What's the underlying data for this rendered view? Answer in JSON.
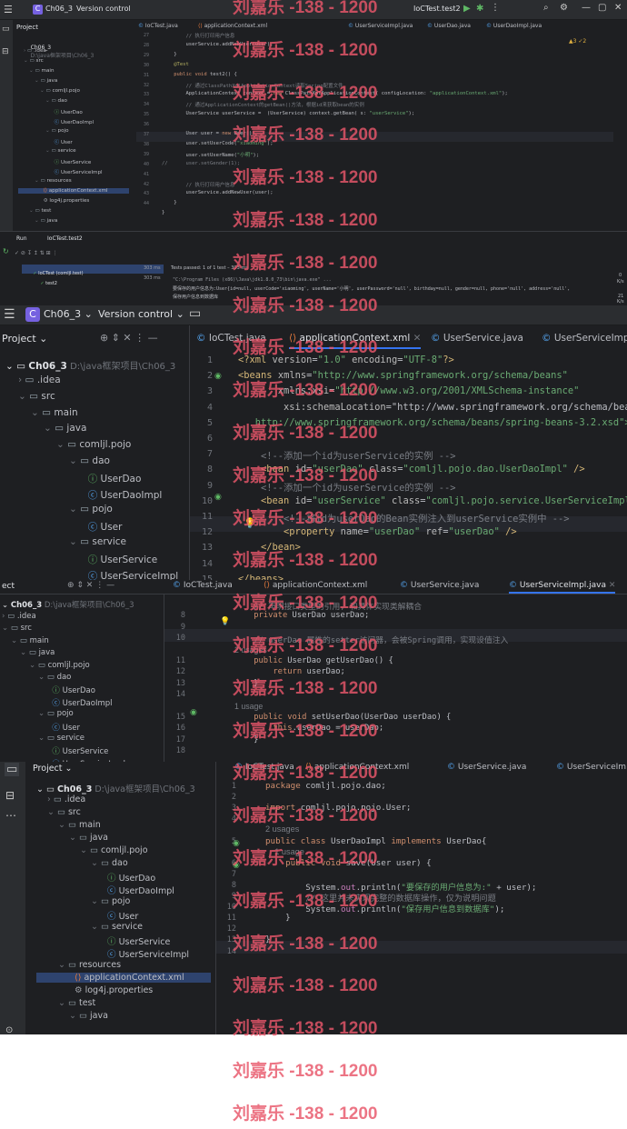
{
  "common": {
    "project_label": "Project",
    "project_name": "Ch06_3",
    "project_path": "D:\\java框架项目\\Ch06_3",
    "vc_label": "Version control",
    "badge_letter": "C"
  },
  "panel1": {
    "run_config": "IoCTest.test2",
    "tabs": [
      "IoCTest.java",
      "applicationContext.xml",
      "UserServiceImpl.java",
      "UserDao.java",
      "UserDaoImpl.java"
    ],
    "tree": [
      ".idea",
      "src",
      "main",
      "java",
      "comljl.pojo",
      "dao",
      "UserDao",
      "UserDaoImpl",
      "pojo",
      "User",
      "service",
      "UserService",
      "UserServiceImpl",
      "resources",
      "applicationContext.xml",
      "log4j.properties",
      "test",
      "java"
    ],
    "gutter": [
      "27",
      "28",
      "29",
      "30",
      "31",
      "32",
      "33",
      "34",
      "35",
      "36",
      "37",
      "38",
      "39",
      "40",
      "41",
      "42",
      "43",
      "44"
    ],
    "code": [
      "        // 执行打印用户信息",
      "        userService.addNewUser(user);",
      "    }",
      "    @Test",
      "    public void test2() {",
      "        // 通过ClassPathXmlApplicationContext读取Spring配置文件",
      "        ApplicationContext context = new ClassPathXmlApplicationContext( configLocation: \"applicationContext.xml\");",
      "        // 通过ApplicationContext的getBean()方法，根据id来获取bean的实例",
      "        UserService userService =  (UserService) context.getBean( s: \"userService\");",
      "",
      "        User user = new User();",
      "        user.setUserCode(\"xiaoming\");",
      "        user.setUserName(\"小明\");",
      "//      user.setGender(1);",
      "",
      "        // 执行打印用户信息",
      "        userService.addNewUser(user);",
      "    }",
      "}"
    ],
    "inspections": "▲3 ✓2",
    "run_label": "Run",
    "run_tab": "IoCTest.test2",
    "tests_passed": "Tests passed: 1 of 1 test – 303 ms",
    "test_class": "IoCTest (comljl.test)",
    "test_class_time": "303 ms",
    "test_method": "test2",
    "test_method_time": "303 ms",
    "console": [
      "\"C:\\Program Files (x86)\\Java\\jdk1.8.0_73\\bin\\java.exe\" ...",
      "要保存的用户信息为:User{id=null, userCode='xiaoming', userName='小明', userPassword='null', birthday=null, gender=null, phone='null', address='null',",
      "保存用户信息到数据库"
    ],
    "status_right": [
      "0",
      "K/s",
      "21",
      "K/s"
    ]
  },
  "panel2": {
    "tabs": [
      "IoCTest.java",
      "applicationContext.xml",
      "UserService.java",
      "UserServiceImpl.java"
    ],
    "tree": [
      "Ch06_3",
      ".idea",
      "src",
      "main",
      "java",
      "comljl.pojo",
      "dao",
      "UserDao",
      "UserDaoImpl",
      "pojo",
      "User",
      "service",
      "UserService",
      "UserServiceImpl"
    ],
    "gutter": [
      "1",
      "2",
      "3",
      "4",
      "5",
      "6",
      "7",
      "8",
      "9",
      "10",
      "11",
      "12",
      "13",
      "14",
      "15"
    ],
    "code": [
      "<?xml version=\"1.0\" encoding=\"UTF-8\"?>",
      "<beans xmlns=\"http://www.springframework.org/schema/beans\"",
      "       xmlns:xsi=\"http://www.w3.org/2001/XMLSchema-instance\"",
      "        xsi:schemaLocation=\"http://www.springframework.org/schema/beans",
      "   http://www.springframework.org/schema/beans/spring-beans-3.2.xsd\">",
      "",
      "    <!--添加一个id为userService的实例 -->",
      "    <bean id=\"userDao\" class=\"comljl.pojo.dao.UserDaoImpl\" />",
      "    <!--添加一个id为userService的实例 -->",
      "    <bean id=\"userService\" class=\"comljl.pojo.service.UserServiceImpl\">",
      "        <!--将id为userDao的Bean实例注入到userService实例中 -->",
      "        <property name=\"userDao\" ref=\"userDao\" />",
      "    </bean>",
      "",
      "</beans>"
    ]
  },
  "panel3": {
    "tabs": [
      "IoCTest.java",
      "applicationContext.xml",
      "UserService.java",
      "UserServiceImpl.java"
    ],
    "tree": [
      ".idea",
      "src",
      "main",
      "java",
      "comljl.pojo",
      "dao",
      "UserDao",
      "UserDaoImpl",
      "pojo",
      "User",
      "service",
      "UserService",
      "UserServiceImpl"
    ],
    "project_stub": "ect",
    "gutter": [
      "",
      "8",
      "9",
      "10",
      "",
      "11",
      "12",
      "13",
      "14",
      "",
      "15",
      "16",
      "17",
      "18"
    ],
    "code": [
      "    // 声明接口类型的引用, 和具体实现类解耦合",
      "    private UserDao userDao;",
      "",
      "    // userDao 属性的setter访问器，会被Spring调用，实现设值注入",
      "2 usages",
      "    public UserDao getUserDao() {",
      "        return userDao;",
      "    }",
      "",
      "1 usage",
      "    public void setUserDao(UserDao userDao) {",
      "        this.userDao = userDao;",
      "    }",
      ""
    ]
  },
  "panel4": {
    "tabs": [
      "IoCTest.java",
      "applicationContext.xml",
      "UserService.java",
      "UserServiceIm"
    ],
    "tree": [
      ".idea",
      "src",
      "main",
      "java",
      "comljl.pojo",
      "dao",
      "UserDao",
      "UserDaoImpl",
      "pojo",
      "User",
      "service",
      "UserService",
      "UserServiceImpl",
      "resources",
      "applicationContext.xml",
      "log4j.properties",
      "test",
      "java"
    ],
    "gutter": [
      "1",
      "2",
      "3",
      "4",
      "",
      "5",
      "",
      "6",
      "7",
      "8",
      "9",
      "10",
      "11",
      "12",
      "13",
      "14"
    ],
    "code": [
      "package comljl.pojo.dao;",
      "",
      "import comljl.pojo.pojo.User;",
      "",
      "2 usages",
      "public class UserDaoImpl implements UserDao{",
      "    1 usage",
      "    public void save(User user) {",
      "",
      "        System.out.println(\"要保存的用户信息为:\" + user);",
      "        // 这里并未实现完整的数据库操作，仅为说明问题",
      "        System.out.println(\"保存用户信息到数据库\");",
      "    }",
      "",
      "}",
      ""
    ]
  },
  "watermark": "刘嘉乐 -138 - 1200"
}
